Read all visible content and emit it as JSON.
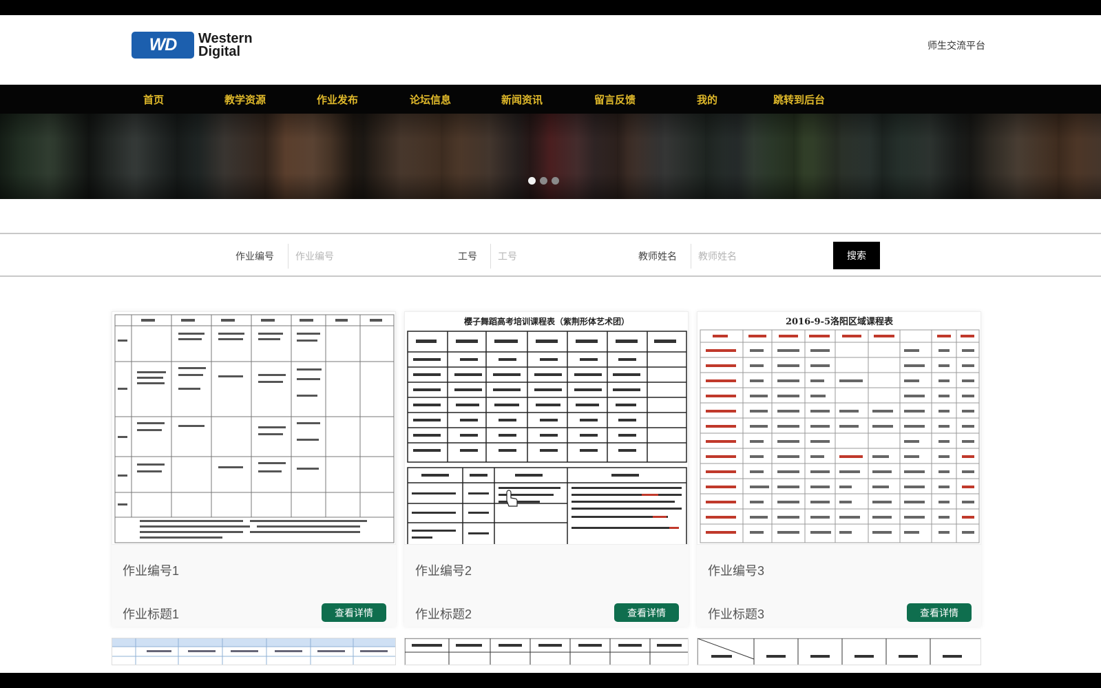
{
  "header": {
    "logo_mark": "WD",
    "logo_line1": "Western",
    "logo_line2": "Digital",
    "platform_name": "师生交流平台"
  },
  "nav": {
    "items": [
      {
        "label": "首页"
      },
      {
        "label": "教学资源"
      },
      {
        "label": "作业发布"
      },
      {
        "label": "论坛信息"
      },
      {
        "label": "新闻资讯"
      },
      {
        "label": "留言反馈"
      },
      {
        "label": "我的"
      },
      {
        "label": "跳转到后台"
      }
    ]
  },
  "banner": {
    "active_slide": 1,
    "slide_count": 3
  },
  "search": {
    "field1_label": "作业编号",
    "field1_placeholder": "作业编号",
    "field2_label": "工号",
    "field2_placeholder": "工号",
    "field3_label": "教师姓名",
    "field3_placeholder": "教师姓名",
    "button_label": "搜索"
  },
  "cards": [
    {
      "number": "作业编号1",
      "title": "作业标题1",
      "button": "查看详情"
    },
    {
      "number": "作业编号2",
      "title": "作业标题2",
      "button": "查看详情",
      "thumb_heading": "樱子舞蹈高考培训课程表（紫荆形体艺术团）"
    },
    {
      "number": "作业编号3",
      "title": "作业标题3",
      "button": "查看详情",
      "thumb_heading": "2016-9-5洛阳区域课程表"
    }
  ],
  "colors": {
    "nav_bg": "#050505",
    "nav_text": "#e0b92a",
    "logo_blue": "#1c5fae",
    "detail_button": "#0f6e4e",
    "search_button": "#000000"
  }
}
